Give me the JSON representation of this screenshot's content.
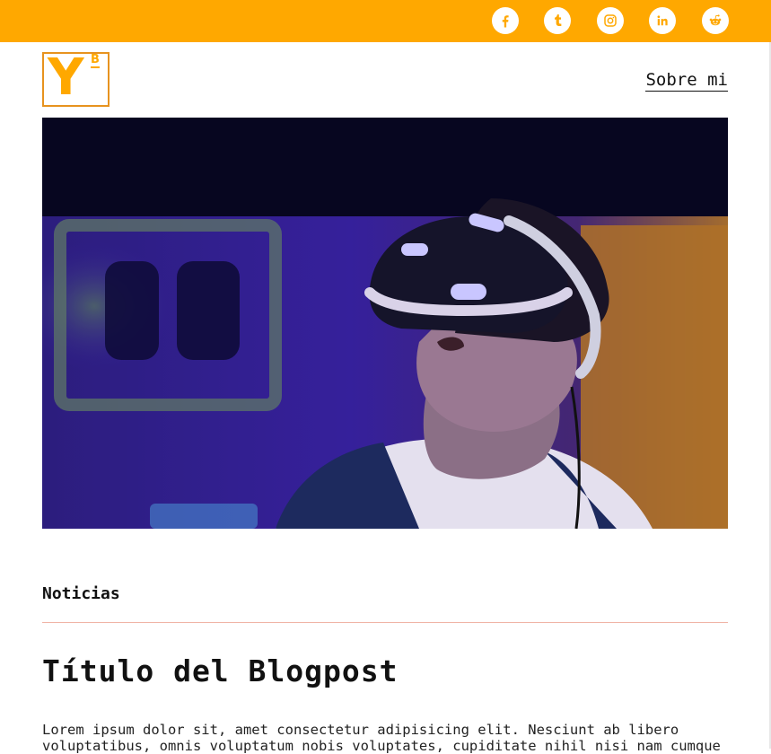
{
  "colors": {
    "accent": "#ffa800",
    "logo_border": "#e7931f",
    "divider": "#f0b4a6"
  },
  "topbar": {
    "social": [
      {
        "icon": "facebook-icon"
      },
      {
        "icon": "tumblr-icon"
      },
      {
        "icon": "instagram-icon"
      },
      {
        "icon": "linkedin-icon"
      },
      {
        "icon": "reddit-icon"
      }
    ]
  },
  "header": {
    "logo": {
      "letter": "Y",
      "superscript": "B"
    },
    "nav_link": "Sobre mi"
  },
  "hero": {
    "image": "person-wearing-vr-headset"
  },
  "post": {
    "category": "Noticias",
    "title": "Título del Blogpost",
    "body_line1": "Lorem ipsum dolor sit, amet consectetur adipisicing elit. Nesciunt ab libero",
    "body_line2": "voluptatibus, omnis voluptatum nobis voluptates, cupiditate nihil nisi nam cumque"
  }
}
